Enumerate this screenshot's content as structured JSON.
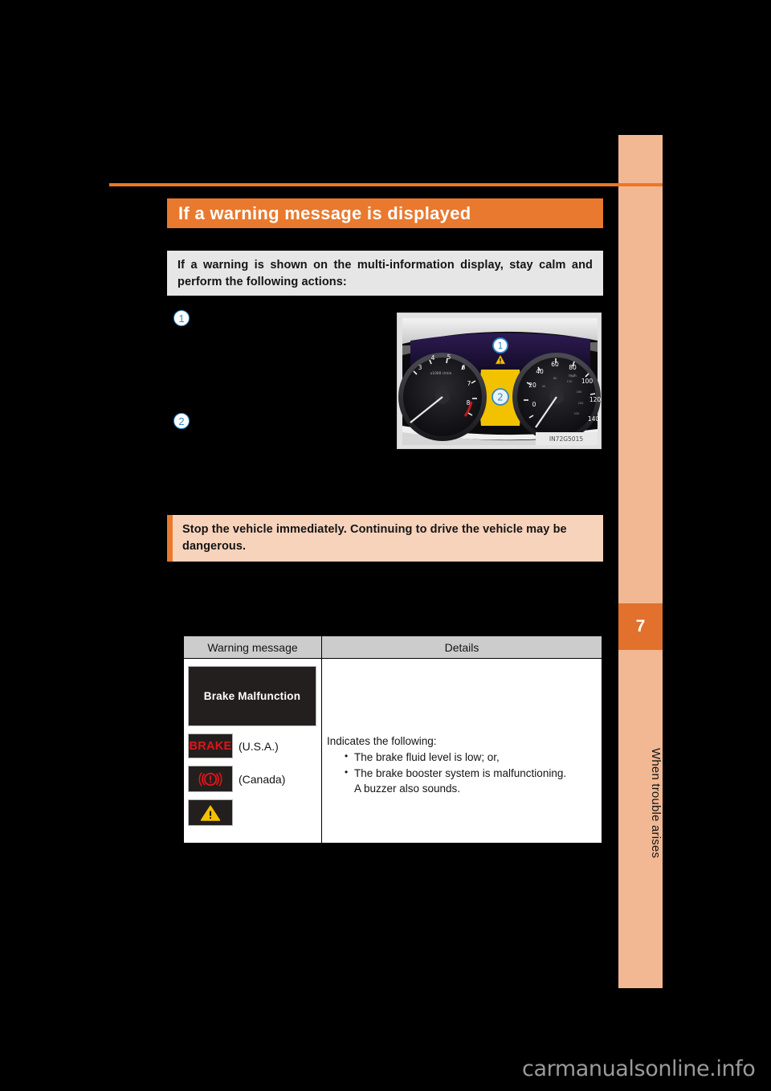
{
  "page": {
    "background_color": "#000000",
    "accent_orange": "#E8792E",
    "accent_rule": "#EE7623",
    "sidebar_tint": "#F2B894"
  },
  "sidebar": {
    "chapter_number": "7",
    "chapter_title": "When trouble arises"
  },
  "section": {
    "title": "If a warning message is displayed"
  },
  "intro": {
    "text": "If a warning is shown on the multi-information display, stay calm and perform the following actions:"
  },
  "steps": [
    {
      "marker": "1"
    },
    {
      "marker": "2"
    }
  ],
  "figure": {
    "caption_code": "IN72G5015",
    "callout_1": "1",
    "callout_2": "2",
    "display_color": "#F2C200",
    "tach_ticks": [
      "3",
      "4",
      "5",
      "6",
      "7",
      "8"
    ],
    "tach_unit": "x1000 r/min",
    "speedo_ticks": [
      "0",
      "20",
      "40",
      "60",
      "80",
      "100",
      "120",
      "140"
    ],
    "speedo_unit": "mph"
  },
  "caution": {
    "text": "Stop the vehicle immediately. Continuing to drive the vehicle may be dangerous."
  },
  "table": {
    "headers": [
      "Warning message",
      "Details"
    ],
    "rows": [
      {
        "message_tile": "Brake Malfunction",
        "icons": [
          {
            "name": "brake-word-icon",
            "glyph": "BRAKE",
            "label": "(U.S.A.)"
          },
          {
            "name": "brake-circle-icon",
            "glyph": "",
            "label": "(Canada)"
          },
          {
            "name": "master-warning-triangle-icon",
            "glyph": "",
            "label": ""
          }
        ],
        "details_intro": "Indicates the following:",
        "details_bullets": [
          "The brake fluid level is low; or,",
          "The brake booster system is malfunctioning."
        ],
        "details_sub": "A buzzer also sounds."
      }
    ]
  },
  "watermark": {
    "text": "carmanualsonline.info"
  }
}
